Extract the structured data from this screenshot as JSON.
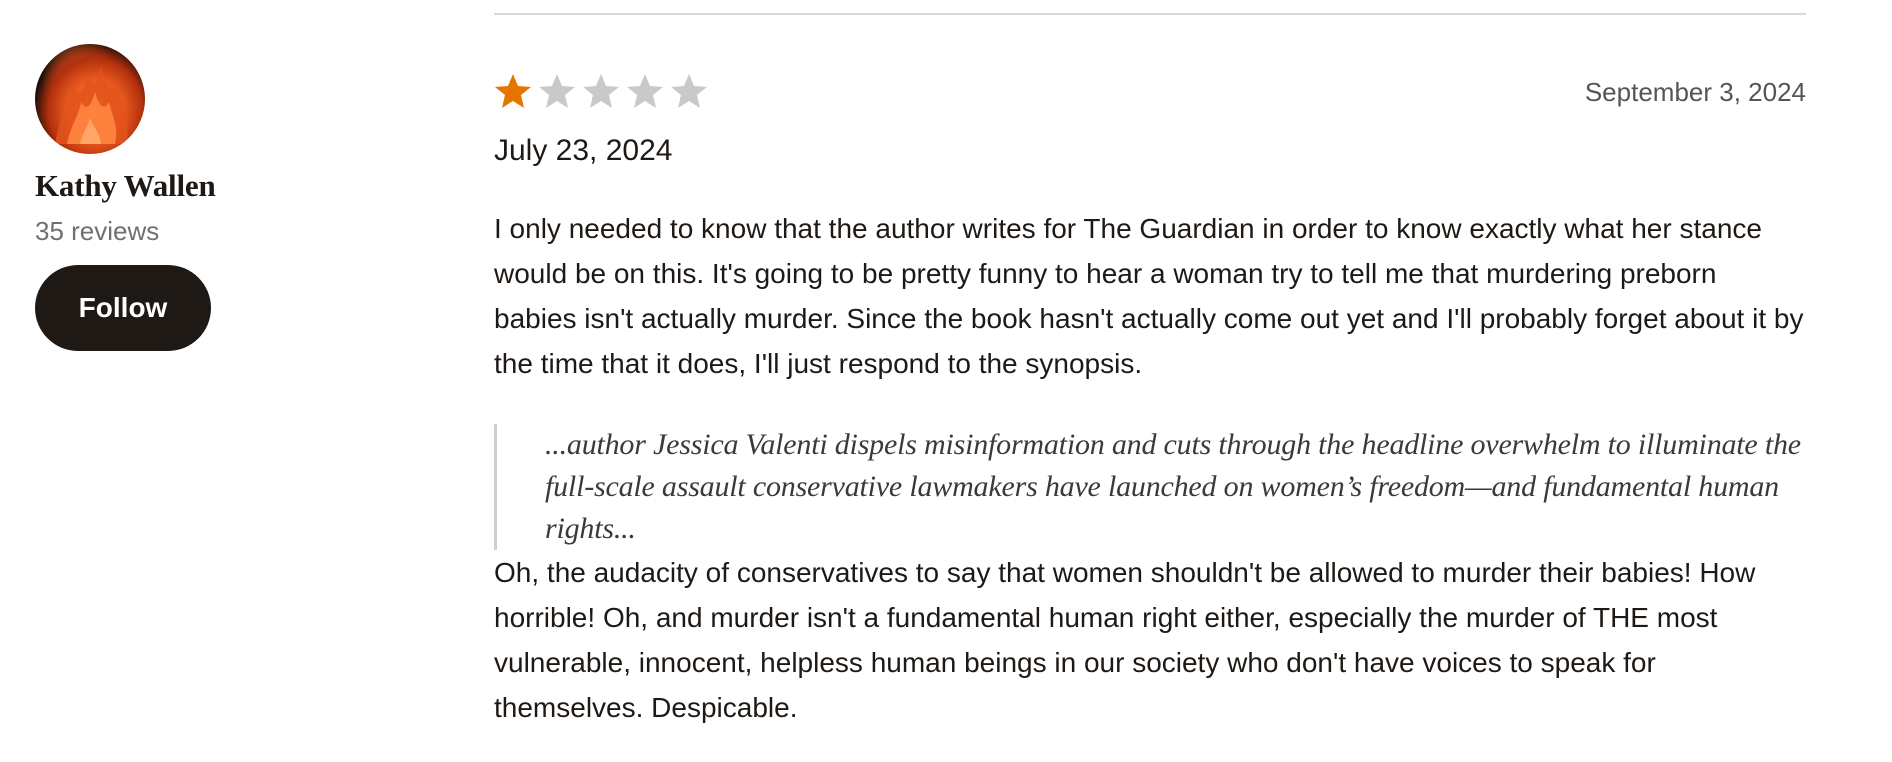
{
  "reviewer": {
    "name": "Kathy Wallen",
    "review_count": "35 reviews",
    "follow_label": "Follow"
  },
  "review": {
    "rating": 1,
    "rating_max": 5,
    "star_filled_color": "#e87400",
    "star_empty_color": "#c9c9c9",
    "review_date": "September 3, 2024",
    "read_date": "July 23, 2024",
    "paragraph_1": "I only needed to know that the author writes for The Guardian in order to know exactly what her stance would be on this. It's going to be pretty funny to hear a woman try to tell me that murdering preborn babies isn't actually murder. Since the book hasn't actually come out yet and I'll probably forget about it by the time that it does, I'll just respond to the synopsis.",
    "quote": "...author Jessica Valenti dispels misinformation and cuts through the headline overwhelm to illuminate the full-scale assault conservative lawmakers have launched on women’s freedom—and fundamental human rights...",
    "paragraph_2": "Oh, the audacity of conservatives to say that women shouldn't be allowed to murder their babies! How horrible! Oh, and murder isn't a fundamental human right either, especially the murder of THE most vulnerable, innocent, helpless human beings in our society who don't have voices to speak for themselves. Despicable."
  }
}
